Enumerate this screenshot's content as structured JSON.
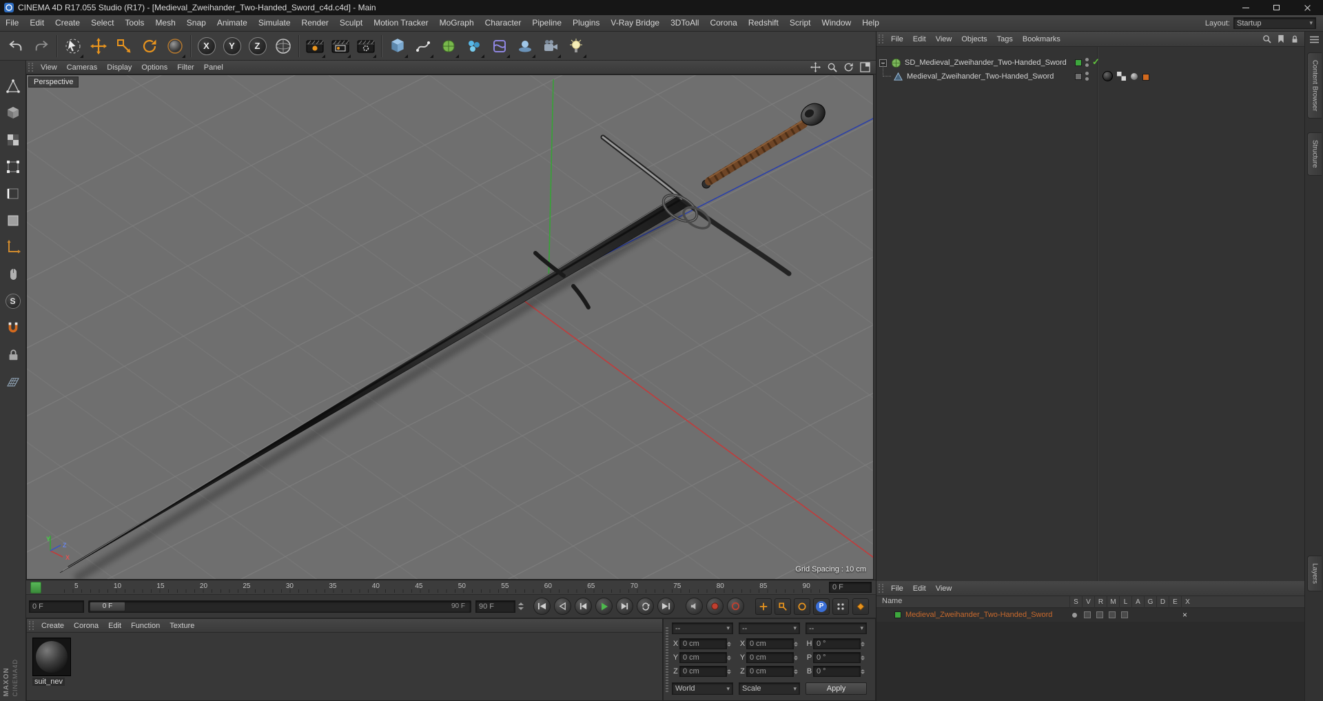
{
  "window": {
    "title": "CINEMA 4D R17.055 Studio (R17) - [Medieval_Zweihander_Two-Handed_Sword_c4d.c4d] - Main"
  },
  "menu_bar": {
    "items": [
      "File",
      "Edit",
      "Create",
      "Select",
      "Tools",
      "Mesh",
      "Snap",
      "Animate",
      "Simulate",
      "Render",
      "Sculpt",
      "Motion Tracker",
      "MoGraph",
      "Character",
      "Pipeline",
      "Plugins",
      "V-Ray Bridge",
      "3DToAll",
      "Corona",
      "Redshift",
      "Script",
      "Window",
      "Help"
    ],
    "layout_label": "Layout:",
    "layout_value": "Startup"
  },
  "toolbar": {
    "axis_locks": [
      "X",
      "Y",
      "Z"
    ]
  },
  "left_toolbar": {
    "solo_label": "S"
  },
  "viewport": {
    "menu": [
      "View",
      "Cameras",
      "Display",
      "Options",
      "Filter",
      "Panel"
    ],
    "view_label": "Perspective",
    "grid_spacing": "Grid Spacing : 10 cm",
    "gizmo": {
      "x": "X",
      "y": "Y",
      "z": "Z"
    }
  },
  "timeline": {
    "ticks": [
      "5",
      "10",
      "15",
      "20",
      "25",
      "30",
      "35",
      "40",
      "45",
      "50",
      "55",
      "60",
      "65",
      "70",
      "75",
      "80",
      "85",
      "90"
    ],
    "ruler_frame": "0 F",
    "current_frame": "0 F",
    "slider_start": "0 F",
    "slider_end": "90 F",
    "end_field": "90 F",
    "parameter_label": "P"
  },
  "materials": {
    "menu": [
      "Create",
      "Corona",
      "Edit",
      "Function",
      "Texture"
    ],
    "material_name": "suit_nev"
  },
  "coordinates": {
    "headers": [
      "--",
      "--",
      "--"
    ],
    "groups": [
      {
        "rows": [
          {
            "label": "X",
            "value": "0 cm"
          },
          {
            "label": "Y",
            "value": "0 cm"
          },
          {
            "label": "Z",
            "value": "0 cm"
          }
        ]
      },
      {
        "rows": [
          {
            "label": "X",
            "value": "0 cm"
          },
          {
            "label": "Y",
            "value": "0 cm"
          },
          {
            "label": "Z",
            "value": "0 cm"
          }
        ]
      },
      {
        "rows": [
          {
            "label": "H",
            "value": "0 °"
          },
          {
            "label": "P",
            "value": "0 °"
          },
          {
            "label": "B",
            "value": "0 °"
          }
        ]
      }
    ],
    "world": "World",
    "size_mode": "Scale",
    "apply": "Apply"
  },
  "object_manager": {
    "menu": [
      "File",
      "Edit",
      "View",
      "Objects",
      "Tags",
      "Bookmarks"
    ],
    "objects": [
      {
        "name": "SD_Medieval_Zweihander_Two-Handed_Sword"
      },
      {
        "name": "Medieval_Zweihander_Two-Handed_Sword"
      }
    ]
  },
  "layers_panel": {
    "menu": [
      "File",
      "Edit",
      "View"
    ],
    "name_header": "Name",
    "columns": [
      "S",
      "V",
      "R",
      "M",
      "L",
      "A",
      "G",
      "D",
      "E",
      "X"
    ],
    "row_name": "Medieval_Zweihander_Two-Handed_Sword"
  },
  "right_tabs": {
    "top": [
      "Content Browser",
      "Structure"
    ],
    "bottom": "Layers"
  },
  "branding": {
    "line1": "MAXON",
    "line2": "CINEMA4D"
  },
  "icons": {
    "check": "✓",
    "cross": "×",
    "dropdown": "▾"
  },
  "colors": {
    "accent_orange": "#e8941e",
    "viewport_bg": "#6f6f6f",
    "selected_text": "#c96a2d",
    "axis_green": "#3fae46",
    "axis_red": "#c23b3b",
    "axis_blue": "#2a3faa"
  }
}
